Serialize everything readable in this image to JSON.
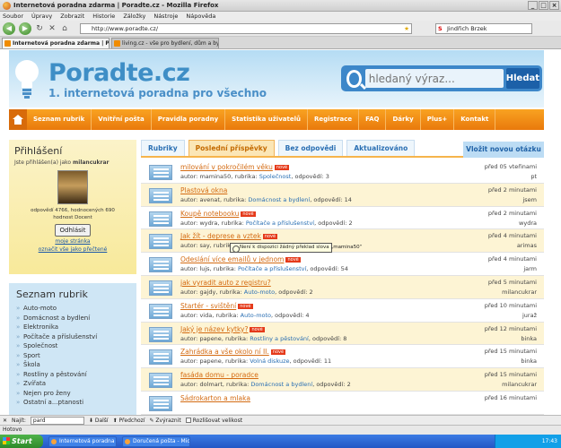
{
  "window": {
    "title": "Internetová poradna zdarma | Poradte.cz - Mozilla Firefox"
  },
  "menu": [
    "Soubor",
    "Úpravy",
    "Zobrazit",
    "Historie",
    "Záložky",
    "Nástroje",
    "Nápověda"
  ],
  "nav": {
    "url": "http://www.poradte.cz/",
    "search_value": "Jindřich Brzek"
  },
  "tabs": [
    "Internetová poradna zdarma | P...",
    "living.cz - vše pro bydlení, dům a byt + ..."
  ],
  "site": {
    "logo": "Poradte.cz",
    "slogan": "1. internetová poradna pro všechno",
    "search_placeholder": "hledaný výraz...",
    "search_button": "Hledat",
    "menu": [
      "Seznam rubrik",
      "Vnitřní pošta",
      "Pravidla poradny",
      "Statistika uživatelů",
      "Registrace",
      "FAQ",
      "Dárky",
      "Plus+",
      "Kontakt"
    ]
  },
  "login": {
    "title": "Přihlášení",
    "logged_prefix": "Jste přihlášen(a) jako ",
    "user": "milancukrar",
    "stats_line1": "odpovědí 4766, hodnocených 690",
    "stats_line2": "hodnost Docent",
    "logout": "Odhlásit",
    "my_page": "moje stránka",
    "mark_read": "označit vše jako přečtené"
  },
  "rubriky": {
    "title": "Seznam rubrik",
    "items": [
      "Auto-moto",
      "Domácnost a bydlení",
      "Elektronika",
      "Počítače a příslušenství",
      "Společnost",
      "Sport",
      "Škola",
      "Rostliny a pěstování",
      "Zvířata",
      "Nejen pro ženy",
      "Ostatní a...ptanosti"
    ]
  },
  "content_tabs": {
    "rubriky": "Rubriky",
    "posledni": "Poslední příspěvky",
    "bez": "Bez odpovědi",
    "aktual": "Aktualizováno",
    "newq": "Vložit novou otázku"
  },
  "labels": {
    "new": "nové",
    "author": "autor: ",
    "rubrika": ", rubrika: ",
    "odpovedi": ", odpovědí: "
  },
  "posts": [
    {
      "title": "milování v pokročilém věku",
      "new": true,
      "author": "mamina50",
      "cat": "Společnost",
      "answers": "3",
      "time": "před 05 vteřinami",
      "user": "pt"
    },
    {
      "title": "Plastová okna",
      "new": false,
      "author": "avenat",
      "cat": "Domácnost a bydlení",
      "answers": "14",
      "time": "před 2 minutami",
      "user": "jsem"
    },
    {
      "title": "Koupě notebooku",
      "new": true,
      "author": "wydra",
      "cat": "Počítače a příslušenství",
      "answers": "2",
      "time": "před 2 minutami",
      "user": "wydra"
    },
    {
      "title": "Jak žít - deprese a vztek",
      "new": true,
      "author": "say",
      "cat": "Společnost",
      "answers": "25",
      "time": "před 4 minutami",
      "user": "arimas"
    },
    {
      "title": "Odeslání více emailů v jednom",
      "new": true,
      "author": "lujs",
      "cat": "Počítače a příslušenství",
      "answers": "54",
      "time": "před 4 minutami",
      "user": "jarm"
    },
    {
      "title": "jak vyradit auto z registru?",
      "new": false,
      "author": "gajdy",
      "cat": "Auto-moto",
      "answers": "2",
      "time": "před 5 minutami",
      "user": "milancukrar"
    },
    {
      "title": "Startér - svištění",
      "new": true,
      "author": "vida",
      "cat": "Auto-moto",
      "answers": "4",
      "time": "před 10 minutami",
      "user": "juraž"
    },
    {
      "title": "Jaký je název kytky?",
      "new": true,
      "author": "papene",
      "cat": "Rostliny a pěstování",
      "answers": "8",
      "time": "před 12 minutami",
      "user": "binka"
    },
    {
      "title": "Zahrádka a vše okolo ní II.",
      "new": true,
      "author": "papene",
      "cat": "Volná diskuze",
      "answers": "11",
      "time": "před 15 minutami",
      "user": "binka"
    },
    {
      "title": "fasáda domu - poradce",
      "new": false,
      "author": "dolmart",
      "cat": "Domácnost a bydlení",
      "answers": "2",
      "time": "před 15 minutami",
      "user": "milancukrar"
    },
    {
      "title": "Sádrokarton a mlaka",
      "new": false,
      "author": "",
      "cat": "",
      "answers": "",
      "time": "před 16 minutami",
      "user": ""
    }
  ],
  "tooltip": "Není k dispozici žádný překlad slova „mamina50“",
  "find": {
    "label": "Najít:",
    "value": "pard",
    "next": "Další",
    "prev": "Předchozí",
    "highlight": "Zvýraznit",
    "match_case": "Rozlišovat velikost"
  },
  "status": "Hotovo",
  "taskbar": {
    "start": "Start",
    "items": [
      "Internetová poradna ...",
      "Doručená pošta - Mic..."
    ],
    "clock": "17:43"
  }
}
